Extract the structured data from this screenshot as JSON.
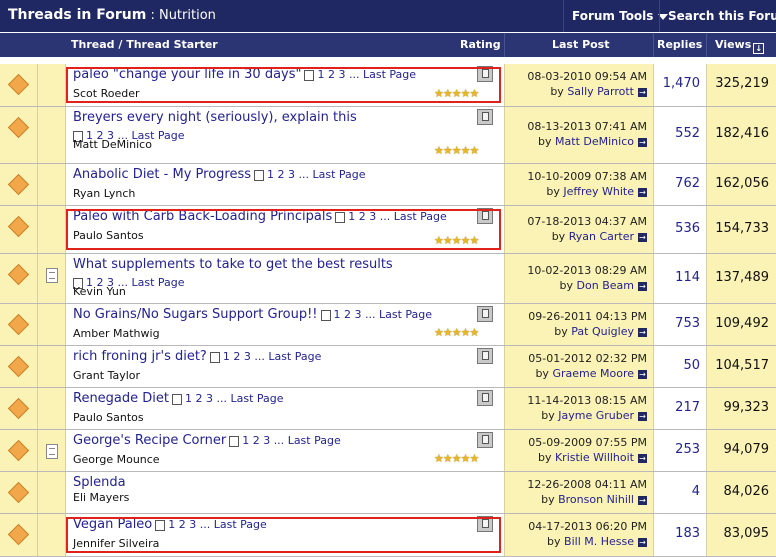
{
  "header": {
    "title": "Threads in Forum",
    "separator": " : ",
    "forum_name": "Nutrition",
    "forum_tools": "Forum Tools",
    "search_forum": "Search this Forum"
  },
  "columns": {
    "thread": "Thread",
    "slash": " / ",
    "thread_starter": "Thread Starter",
    "rating": "Rating",
    "last_post": "Last Post",
    "replies": "Replies",
    "views": "Views",
    "views_sort_glyph": "↓"
  },
  "labels": {
    "pages": "1 2 3 ...",
    "last_page": "Last Page",
    "by": "by"
  },
  "colors": {
    "header_bg": "#1f2862",
    "row_yellow": "#fbf2b5",
    "link": "#23238e",
    "highlight": "#e0221b",
    "icon_orange": "#f2a84a"
  },
  "threads": [
    {
      "title": "paleo \"change your life in 30 days\"",
      "pages": "1 2 3 ...",
      "last_page": "Last Page",
      "starter": "Scot Roeder",
      "stars": "★★★★★",
      "date": "08-03-2010",
      "time": "09:54 AM",
      "by": "by",
      "user": "Sally Parrott",
      "replies": "1,470",
      "views": "325,219",
      "highlighted": true,
      "has_note": false
    },
    {
      "title": "Breyers every night (seriously), explain this",
      "pages": "1 2 3 ...",
      "last_page": "Last Page",
      "starter": "Matt DeMinico",
      "stars": "★★★★★",
      "date": "08-13-2013",
      "time": "07:41 AM",
      "by": "by",
      "user": "Matt DeMinico",
      "replies": "552",
      "views": "182,416",
      "highlighted": false,
      "has_note": false
    },
    {
      "title": "Anabolic Diet - My Progress",
      "pages": "1 2 3 ...",
      "last_page": "Last Page",
      "starter": "Ryan Lynch",
      "stars": "",
      "date": "10-10-2009",
      "time": "07:38 AM",
      "by": "by",
      "user": "Jeffrey White",
      "replies": "762",
      "views": "162,056",
      "highlighted": false,
      "has_note": false
    },
    {
      "title": "Paleo with Carb Back-Loading Principals",
      "pages": "1 2 3 ...",
      "last_page": "Last Page",
      "starter": "Paulo Santos",
      "stars": "★★★★★",
      "date": "07-18-2013",
      "time": "04:37 AM",
      "by": "by",
      "user": "Ryan Carter",
      "replies": "536",
      "views": "154,733",
      "highlighted": true,
      "has_note": false
    },
    {
      "title": "What supplements to take to get the best results",
      "pages": "1 2 3 ...",
      "last_page": "Last Page",
      "starter": "Kevin Yun",
      "stars": "",
      "date": "10-02-2013",
      "time": "08:29 AM",
      "by": "by",
      "user": "Don Beam",
      "replies": "114",
      "views": "137,489",
      "highlighted": false,
      "has_note": true
    },
    {
      "title": "No Grains/No Sugars Support Group!!",
      "pages": "1 2 3 ...",
      "last_page": "Last Page",
      "starter": "Amber Mathwig",
      "stars": "★★★★★",
      "date": "09-26-2011",
      "time": "04:13 PM",
      "by": "by",
      "user": "Pat Quigley",
      "replies": "753",
      "views": "109,492",
      "highlighted": false,
      "has_note": false
    },
    {
      "title": "rich froning jr's diet?",
      "pages": "1 2 3 ...",
      "last_page": "Last Page",
      "starter": "Grant Taylor",
      "stars": "",
      "date": "05-01-2012",
      "time": "02:32 PM",
      "by": "by",
      "user": "Graeme Moore",
      "replies": "50",
      "views": "104,517",
      "highlighted": false,
      "has_note": false
    },
    {
      "title": "Renegade Diet",
      "pages": "1 2 3 ...",
      "last_page": "Last Page",
      "starter": "Paulo Santos",
      "stars": "",
      "date": "11-14-2013",
      "time": "08:15 AM",
      "by": "by",
      "user": "Jayme Gruber",
      "replies": "217",
      "views": "99,323",
      "highlighted": false,
      "has_note": false
    },
    {
      "title": "George's Recipe Corner",
      "pages": "1 2 3 ...",
      "last_page": "Last Page",
      "starter": "George Mounce",
      "stars": "★★★★★",
      "date": "05-09-2009",
      "time": "07:55 PM",
      "by": "by",
      "user": "Kristie Willhoit",
      "replies": "253",
      "views": "94,079",
      "highlighted": false,
      "has_note": true
    },
    {
      "title": "Splenda",
      "pages": "",
      "last_page": "",
      "starter": "Eli Mayers",
      "stars": "",
      "date": "12-26-2008",
      "time": "04:11 AM",
      "by": "by",
      "user": "Bronson Nihill",
      "replies": "4",
      "views": "84,026",
      "highlighted": false,
      "has_note": false
    },
    {
      "title": "Vegan Paleo",
      "pages": "1 2 3 ...",
      "last_page": "Last Page",
      "starter": "Jennifer Silveira",
      "stars": "",
      "date": "04-17-2013",
      "time": "06:20 PM",
      "by": "by",
      "user": "Bill M. Hesse",
      "replies": "183",
      "views": "83,095",
      "highlighted": true,
      "has_note": false
    }
  ]
}
